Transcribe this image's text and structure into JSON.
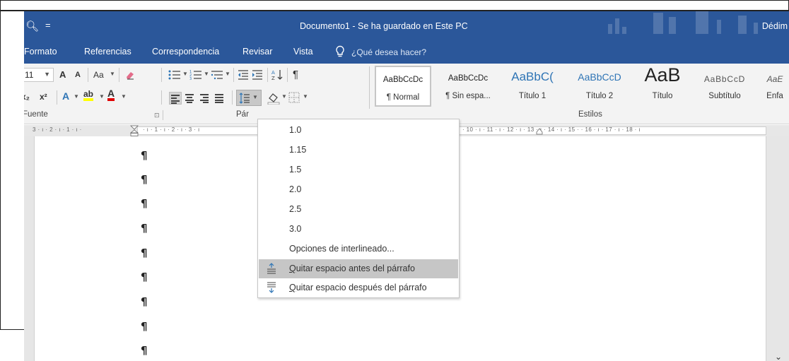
{
  "titlebar": {
    "qat_icon": "print-preview-icon",
    "qat_dropdown": "=",
    "title": "Documento1  -  Se ha guardado en Este PC",
    "user": "Dédim"
  },
  "tabs": [
    {
      "label": "Formato"
    },
    {
      "label": "Referencias"
    },
    {
      "label": "Correspondencia"
    },
    {
      "label": "Revisar"
    },
    {
      "label": "Vista"
    }
  ],
  "tell_me": {
    "icon": "lightbulb-icon",
    "placeholder": "¿Qué desea hacer?"
  },
  "ribbon": {
    "font_size": "11",
    "grow_font": "A",
    "shrink_font": "A",
    "change_case": "Aa",
    "subscript": "x₂",
    "superscript": "x²",
    "text_effects": "A",
    "highlight": "ab",
    "font_color": "A",
    "sort": "↓",
    "show_marks": "¶",
    "group_font": "Fuente",
    "group_paragraph": "Pár",
    "group_styles": "Estilos"
  },
  "styles": [
    {
      "sample": "AaBbCcDc",
      "name": "¶ Normal"
    },
    {
      "sample": "AaBbCcDc",
      "name": "¶ Sin espa..."
    },
    {
      "sample": "AaBbC(",
      "name": "Título 1"
    },
    {
      "sample": "AaBbCcD",
      "name": "Título 2"
    },
    {
      "sample": "AaB",
      "name": "Título"
    },
    {
      "sample": "AaBbCcD",
      "name": "Subtítulo"
    },
    {
      "sample": "AaE",
      "name": "Énfa"
    }
  ],
  "ruler": {
    "left_numbers": "3 · ı · 2 · ı · 1 · ı ·",
    "mid_numbers": "· ı · 1 · ı · 2 · ı · 3 · ı",
    "right_numbers": "· 10 · ı · 11 · ı · 12 · ı · 13 · ı · 14 · ı · 15 ·    · 16 · ı · 17 · ı · 18 · ı"
  },
  "pilcrows": [
    "¶",
    "¶",
    "¶",
    "¶",
    "¶",
    "¶",
    "¶",
    "¶",
    "¶"
  ],
  "line_spacing_menu": {
    "options": [
      {
        "label": "1.0"
      },
      {
        "label": "1.15"
      },
      {
        "label": "1.5"
      },
      {
        "label": "2.0"
      },
      {
        "label": "2.5"
      },
      {
        "label": "3.0"
      },
      {
        "label": "Opciones de interlineado..."
      }
    ],
    "remove_before": {
      "underlined": "Q",
      "rest": "uitar espacio antes del párrafo",
      "icon": "space-before-icon"
    },
    "remove_after": {
      "underlined": "Q",
      "rest": "uitar espacio después del párrafo",
      "icon": "space-after-icon"
    }
  },
  "colors": {
    "accent": "#2b579a",
    "ribbon_bg": "#f3f3f3",
    "menu_hover": "#c6c6c6"
  }
}
